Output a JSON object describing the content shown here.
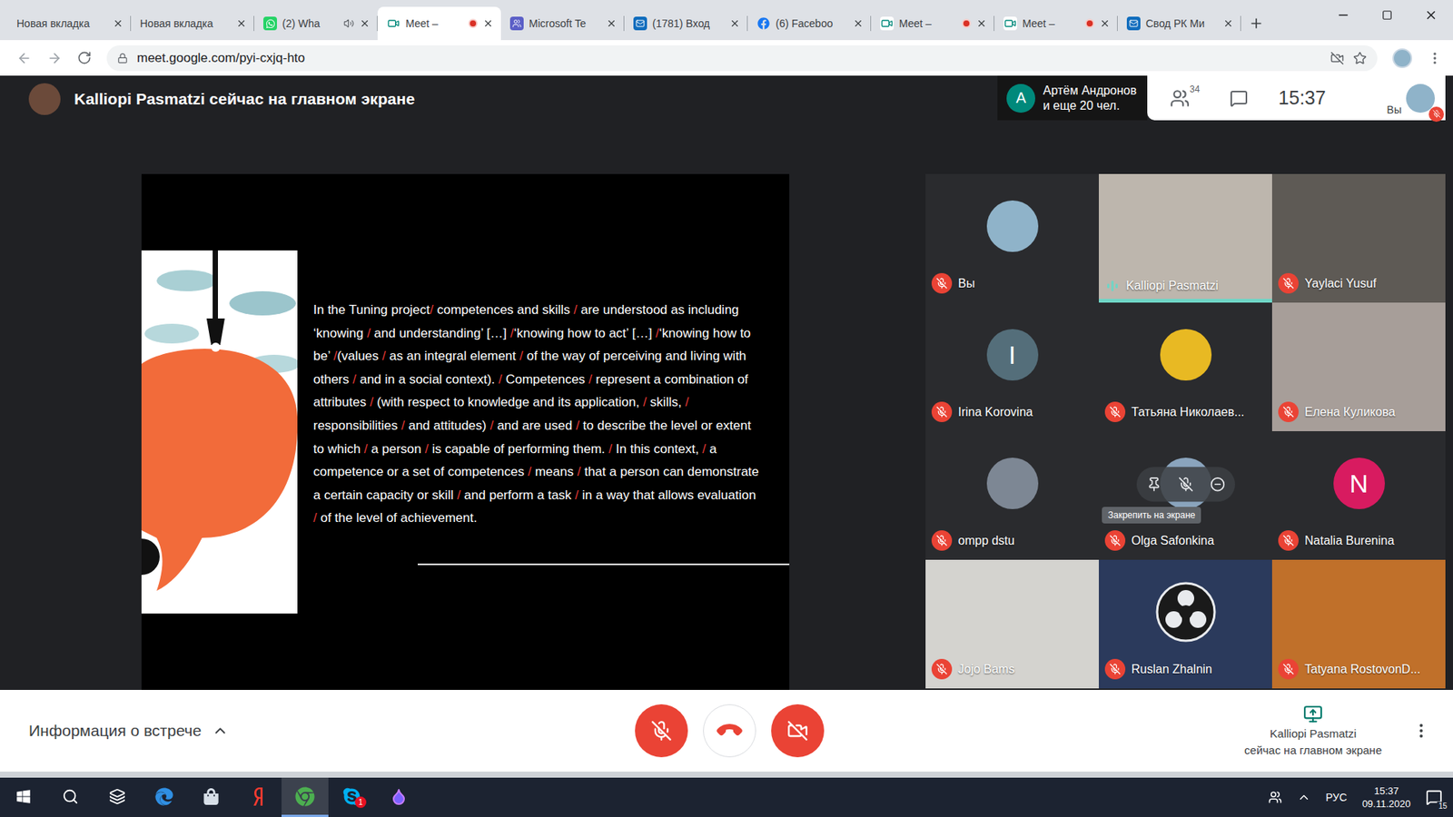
{
  "browser": {
    "tabs": [
      {
        "label": "Новая вкладка",
        "kind": "blank",
        "selected": false,
        "recording": false,
        "audio": false
      },
      {
        "label": "Новая вкладка",
        "kind": "blank",
        "selected": false,
        "recording": false,
        "audio": false
      },
      {
        "label": "(2) Wha",
        "kind": "whatsapp",
        "selected": false,
        "recording": false,
        "audio": true
      },
      {
        "label": "Meet –",
        "kind": "meet",
        "selected": true,
        "recording": true,
        "audio": false
      },
      {
        "label": "Microsoft Te",
        "kind": "teams",
        "selected": false,
        "recording": false,
        "audio": false
      },
      {
        "label": "(1781) Вход",
        "kind": "mail",
        "selected": false,
        "recording": false,
        "audio": false
      },
      {
        "label": "(6) Faceboo",
        "kind": "facebook",
        "selected": false,
        "recording": false,
        "audio": false
      },
      {
        "label": "Meet –",
        "kind": "meet",
        "selected": false,
        "recording": true,
        "audio": false
      },
      {
        "label": "Meet –",
        "kind": "meet",
        "selected": false,
        "recording": true,
        "audio": false
      },
      {
        "label": "Свод РК Ми",
        "kind": "mail",
        "selected": false,
        "recording": false,
        "audio": false
      }
    ],
    "url": "meet.google.com/pyi-cxjq-hto"
  },
  "meet": {
    "presenter_banner": "Kalliopi Pasmatzi сейчас на главном экране",
    "participants_summary": {
      "initial": "A",
      "name": "Артём Андронов",
      "rest": "и еще 20 чел."
    },
    "people_count": "34",
    "time": "15:37",
    "self_label": "Вы",
    "self_muted": true
  },
  "slide": {
    "separator": "/",
    "segments": [
      "In the Tuning project",
      " competences and skills ",
      " are understood as including ‘knowing ",
      " and understanding’ […] ",
      "‘knowing how to act’ […] ",
      "‘knowing how to be’ ",
      "(values ",
      " as an integral element ",
      " of the way of perceiving and living with others ",
      " and in a social context). ",
      " Competences ",
      " represent a combination of attributes ",
      " (with respect to knowledge and its application, ",
      " skills, ",
      " responsibilities ",
      " and attitudes) ",
      " and are used ",
      " to describe the level or extent to which ",
      " a person ",
      " is capable of performing them. ",
      " In this context, ",
      " a competence or a set of competences ",
      " means ",
      " that a person can demonstrate a certain capacity or skill ",
      " and perform a task ",
      " in a way that allows evaluation ",
      " of the level of achievement."
    ]
  },
  "tiles": [
    {
      "name": "Вы",
      "kind": "avatar",
      "color": "#8fb3c9",
      "muted": true,
      "speaking": false,
      "hovered": false
    },
    {
      "name": "Kalliopi Pasmatzi",
      "kind": "video",
      "color": "#bdb6ad",
      "muted": false,
      "speaking": true,
      "hovered": false
    },
    {
      "name": "Yaylaci Yusuf",
      "kind": "video",
      "color": "#5e5a55",
      "muted": true,
      "speaking": false,
      "hovered": false
    },
    {
      "name": "Irina Korovina",
      "kind": "letter",
      "initial": "I",
      "color": "#546e7a",
      "muted": true,
      "speaking": false,
      "hovered": false
    },
    {
      "name": "Татьяна Николаев...",
      "kind": "avatar",
      "color": "#e8b923",
      "muted": true,
      "speaking": false,
      "hovered": false
    },
    {
      "name": "Елена Куликова",
      "kind": "video",
      "color": "#a79e99",
      "muted": true,
      "speaking": false,
      "hovered": false
    },
    {
      "name": "ompp dstu",
      "kind": "avatar",
      "color": "#7d8794",
      "muted": true,
      "speaking": false,
      "hovered": false
    },
    {
      "name": "Olga Safonkina",
      "kind": "avatar",
      "color": "#8aa4bd",
      "muted": true,
      "speaking": false,
      "hovered": true,
      "tooltip": "Закрепить на экране"
    },
    {
      "name": "Natalia Burenina",
      "kind": "letter",
      "initial": "N",
      "color": "#d81b60",
      "muted": true,
      "speaking": false,
      "hovered": false
    },
    {
      "name": "Jojo Bams",
      "kind": "video",
      "color": "#d4d3cf",
      "muted": true,
      "speaking": false,
      "hovered": false
    },
    {
      "name": "Ruslan Zhalnin",
      "kind": "logo",
      "color": "#2b3a5c",
      "muted": true,
      "speaking": false,
      "hovered": false
    },
    {
      "name": "Tatyana RostovonD...",
      "kind": "video",
      "color": "#c0702a",
      "muted": true,
      "speaking": false,
      "hovered": false
    }
  ],
  "controls": {
    "info": "Информация о встрече",
    "mic_muted": true,
    "camera_off": true,
    "presenting_name": "Kalliopi Pasmatzi",
    "presenting_note": "сейчас на главном экране"
  },
  "taskbar": {
    "apps": [
      {
        "kind": "start",
        "active": false
      },
      {
        "kind": "search",
        "active": false
      },
      {
        "kind": "taskview",
        "active": false
      },
      {
        "kind": "edge",
        "active": false
      },
      {
        "kind": "store",
        "active": false
      },
      {
        "kind": "yandex",
        "active": false
      },
      {
        "kind": "chrome",
        "active": true
      },
      {
        "kind": "skype",
        "active": false,
        "badge": "1"
      },
      {
        "kind": "paint",
        "active": false
      }
    ],
    "language": "РУС",
    "time": "15:37",
    "date": "09.11.2020",
    "notifications": "15"
  }
}
